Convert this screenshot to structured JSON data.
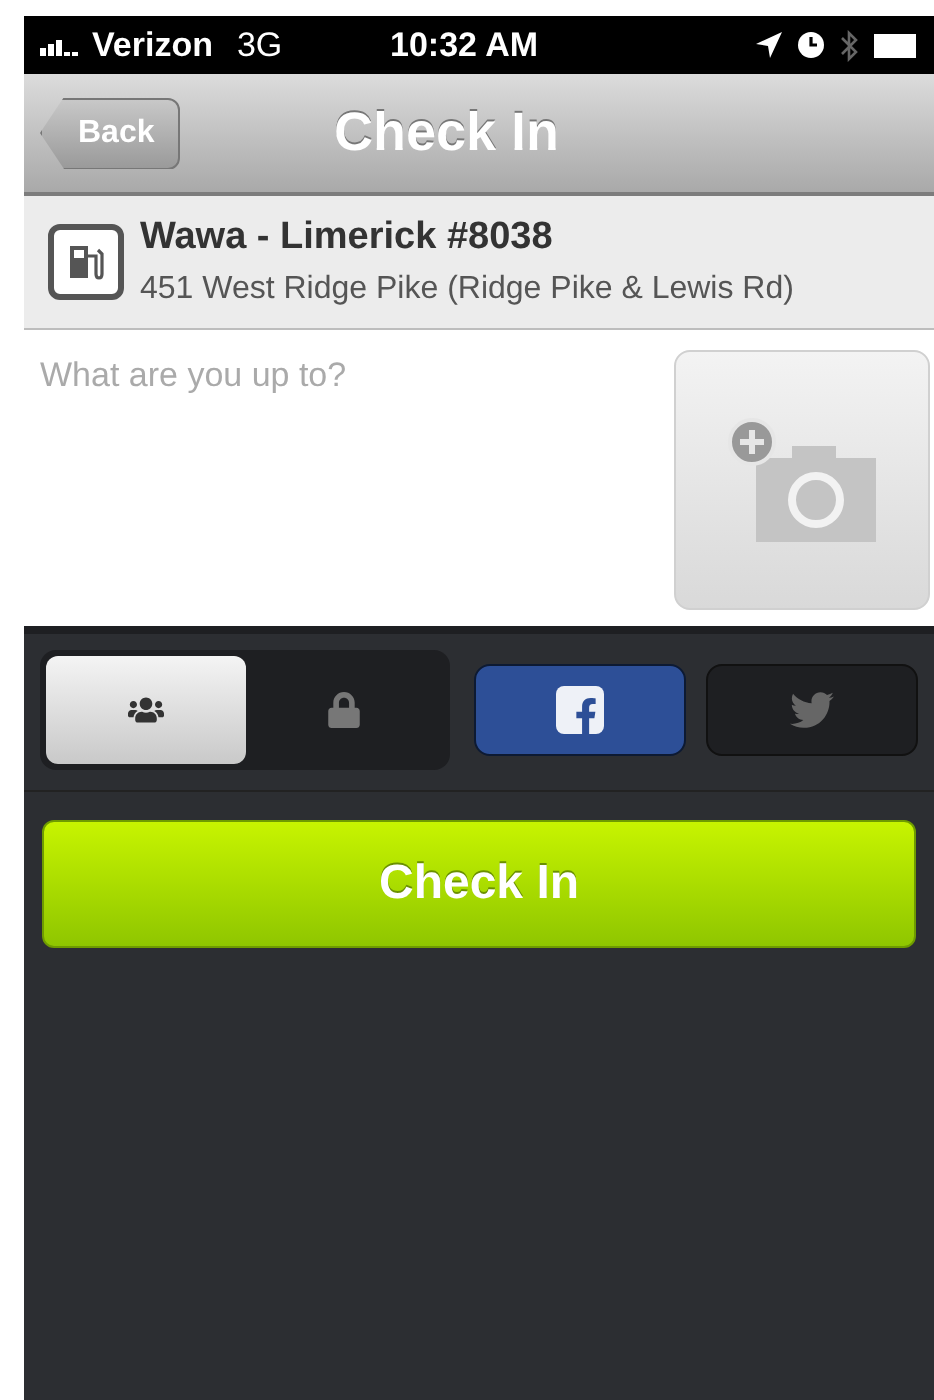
{
  "status_bar": {
    "carrier": "Verizon",
    "network": "3G",
    "time": "10:32 AM"
  },
  "nav": {
    "back": "Back",
    "title": "Check In"
  },
  "venue": {
    "name": "Wawa - Limerick #8038",
    "address": "451 West Ridge Pike (Ridge Pike & Lewis Rd)"
  },
  "compose": {
    "placeholder": "What are you up to?"
  },
  "privacy": [
    {
      "kind": "public",
      "selected": true
    },
    {
      "kind": "private",
      "selected": false
    }
  ],
  "share": [
    {
      "kind": "facebook",
      "on": true
    },
    {
      "kind": "twitter",
      "on": false
    }
  ],
  "submit": "Check In"
}
